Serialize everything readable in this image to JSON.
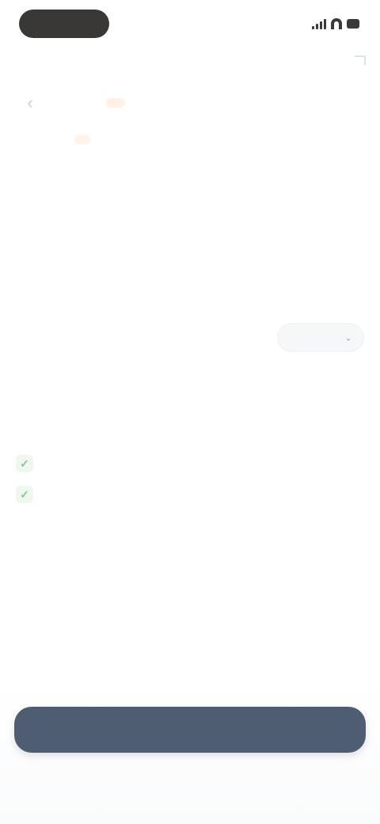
{
  "status_bar": {
    "time": "",
    "icons": [
      "signal-icon",
      "wifi-icon",
      "battery-icon"
    ]
  },
  "header": {
    "title": "",
    "badge": ""
  },
  "tabs": {
    "active": "",
    "inactive": ""
  },
  "summary": {
    "section_title": "",
    "amount": "",
    "unit": "",
    "description": ""
  },
  "settings": {
    "label": "",
    "value": ""
  },
  "info": {
    "text": ""
  },
  "rules": {
    "title": "",
    "items": [
      {
        "icon": "check-icon",
        "text": ""
      },
      {
        "icon": "check-icon",
        "text": ""
      }
    ]
  },
  "actions": {
    "primary_label": "",
    "secondary_label": ""
  },
  "colors": {
    "accent": "#f3a36f",
    "button": "#4f5d72",
    "success": "#88c795",
    "link": "#8fb8ee"
  }
}
